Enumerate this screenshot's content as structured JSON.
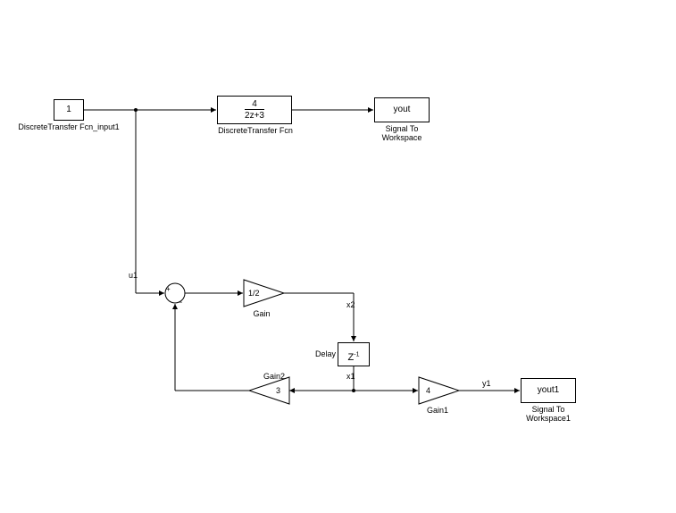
{
  "blocks": {
    "constant": {
      "value": "1",
      "label": "DiscreteTransfer Fcn_input1"
    },
    "dtf": {
      "num": "4",
      "den": "2z+3",
      "label": "DiscreteTransfer Fcn"
    },
    "stw": {
      "var": "yout",
      "label": "Signal To\nWorkspace"
    },
    "sum": {
      "ports": "+−"
    },
    "gain": {
      "value": "1/2",
      "label": "Gain"
    },
    "delay": {
      "text": "Z",
      "exp": "-1",
      "label": "Delay"
    },
    "gain2": {
      "value": "3",
      "label": "Gain2"
    },
    "gain1": {
      "value": "4",
      "label": "Gain1"
    },
    "stw1": {
      "var": "yout1",
      "label": "Signal To\nWorkspace1"
    }
  },
  "signals": {
    "u1": "u1",
    "x2": "x2",
    "x1": "x1",
    "y1": "y1"
  }
}
